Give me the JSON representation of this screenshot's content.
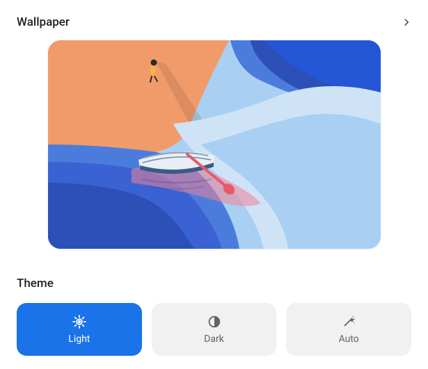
{
  "wallpaper": {
    "section_title": "Wallpaper",
    "description": "Beach scene with boat and figure walking on sand",
    "colors": {
      "sand": "#f29b6a",
      "water_light": "#a9d0f2",
      "water_mid": "#4b7cdc",
      "water_deep": "#2c4fb8",
      "boat_light": "#e8eef4",
      "boat_dark": "#3a5a88",
      "paddle": "#e85a6a",
      "figure": "#2b2b2b",
      "figure_cloth": "#f7b24a"
    }
  },
  "theme": {
    "section_title": "Theme",
    "options": [
      {
        "id": "light",
        "label": "Light",
        "selected": true
      },
      {
        "id": "dark",
        "label": "Dark",
        "selected": false
      },
      {
        "id": "auto",
        "label": "Auto",
        "selected": false
      }
    ]
  }
}
